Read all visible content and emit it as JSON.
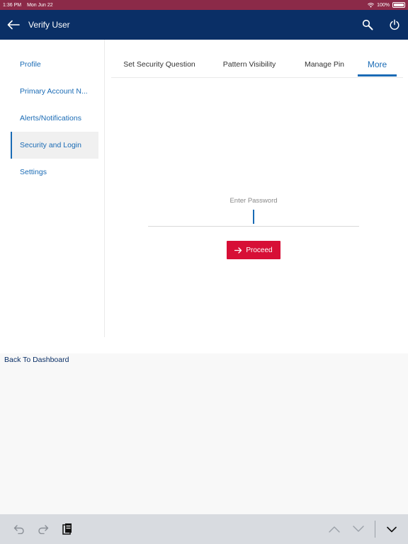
{
  "status_bar": {
    "time": "1:36 PM",
    "date": "Mon Jun 22",
    "battery": "100%",
    "wifi_icon": "wifi-icon",
    "battery_icon": "battery-icon"
  },
  "app_bar": {
    "title": "Verify User",
    "back_icon": "arrow-left-icon",
    "search_icon": "search-icon",
    "power_icon": "power-icon",
    "background_color": "#0a2f66"
  },
  "sidebar": {
    "items": [
      {
        "label": "Profile",
        "active": false
      },
      {
        "label": "Primary Account N...",
        "active": false
      },
      {
        "label": "Alerts/Notifications",
        "active": false
      },
      {
        "label": "Security and Login",
        "active": true
      },
      {
        "label": "Settings",
        "active": false
      }
    ]
  },
  "tabs": [
    {
      "label": "Set Security Question",
      "active": false
    },
    {
      "label": "Pattern Visibility",
      "active": false
    },
    {
      "label": "Manage Pin",
      "active": false
    },
    {
      "label": "More",
      "active": true
    }
  ],
  "password": {
    "label": "Enter Password",
    "value": ""
  },
  "proceed": {
    "label": "Proceed",
    "icon": "arrow-right-icon",
    "color": "#d70f36"
  },
  "footer": {
    "back_to_dashboard": "Back To Dashboard"
  },
  "keyboard_bar": {
    "undo_icon": "undo-icon",
    "redo_icon": "redo-icon",
    "paste_icon": "clipboard-icon",
    "prev_icon": "chevron-up-icon",
    "next_icon": "chevron-down-icon",
    "dismiss_icon": "keyboard-dismiss-icon"
  },
  "colors": {
    "accent": "#1a6bb5",
    "status_bar": "#8b2a48"
  }
}
